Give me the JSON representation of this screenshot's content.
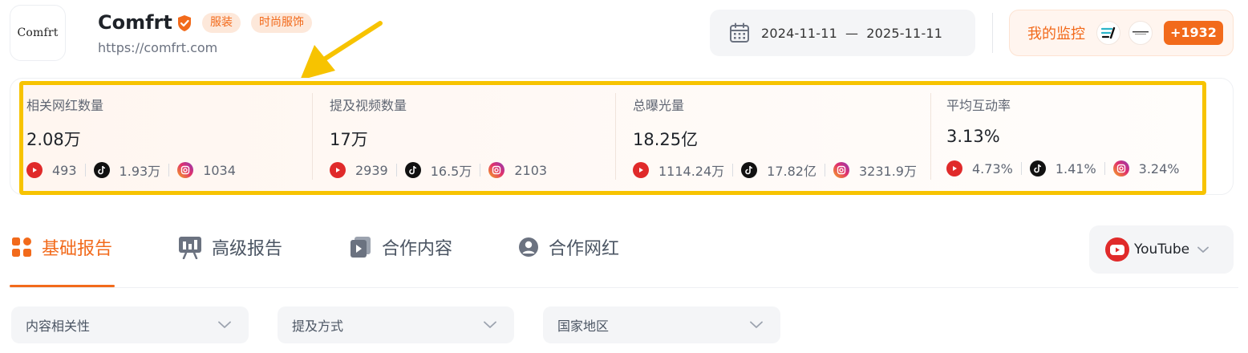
{
  "brand": {
    "logo_text": "Comfrt",
    "name": "Comfrt",
    "tags": [
      "服装",
      "时尚服饰"
    ],
    "url": "https://comfrt.com"
  },
  "date_range": {
    "start": "2024-11-11",
    "separator": "—",
    "end": "2025-11-11"
  },
  "monitor": {
    "label": "我的监控",
    "count": "+1932"
  },
  "stats": [
    {
      "label": "相关网红数量",
      "value": "2.08万",
      "youtube": "493",
      "tiktok": "1.93万",
      "instagram": "1034"
    },
    {
      "label": "提及视频数量",
      "value": "17万",
      "youtube": "2939",
      "tiktok": "16.5万",
      "instagram": "2103"
    },
    {
      "label": "总曝光量",
      "value": "18.25亿",
      "youtube": "1114.24万",
      "tiktok": "17.82亿",
      "instagram": "3231.9万"
    },
    {
      "label": "平均互动率",
      "value": "3.13%",
      "youtube": "4.73%",
      "tiktok": "1.41%",
      "instagram": "3.24%"
    }
  ],
  "tabs": [
    {
      "label": "基础报告",
      "icon": "grid-icon",
      "active": true
    },
    {
      "label": "高级报告",
      "icon": "presentation-icon",
      "active": false
    },
    {
      "label": "合作内容",
      "icon": "video-file-icon",
      "active": false
    },
    {
      "label": "合作网红",
      "icon": "user-icon",
      "active": false
    }
  ],
  "platform_select": {
    "value": "YouTube"
  },
  "filters": [
    "内容相关性",
    "提及方式",
    "国家地区"
  ],
  "colors": {
    "accent": "#f26a1b",
    "highlight_border": "#f7c300",
    "youtube": "#e02a2a"
  }
}
